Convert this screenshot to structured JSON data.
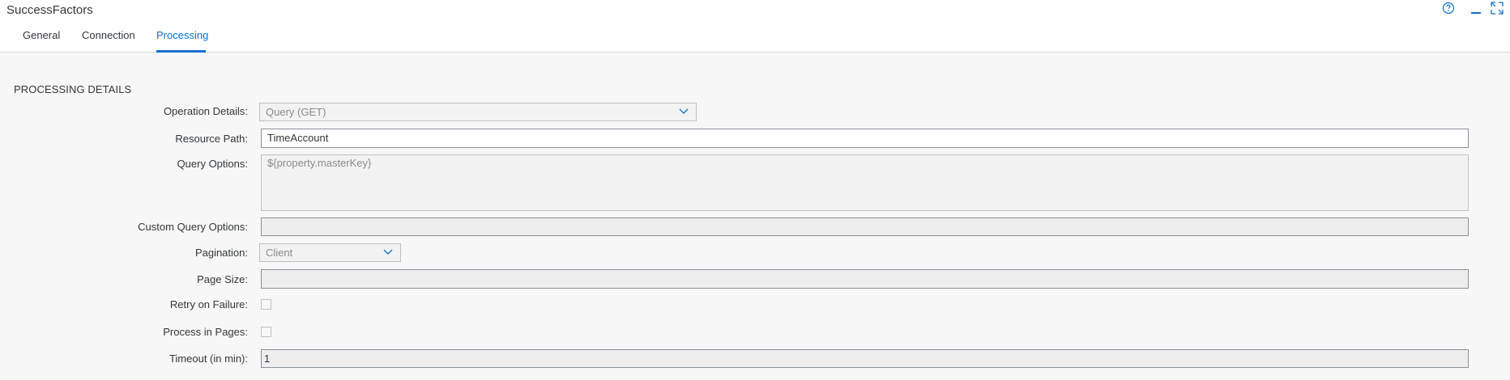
{
  "app": {
    "title": "SuccessFactors",
    "tabs": [
      {
        "label": "General"
      },
      {
        "label": "Connection"
      },
      {
        "label": "Processing",
        "active": true
      }
    ],
    "icons": {
      "help": "help-icon",
      "minimize": "minimize-icon",
      "expand": "expand-icon"
    }
  },
  "section": {
    "title": "PROCESSING DETAILS"
  },
  "form": {
    "operation_details": {
      "label": "Operation Details:",
      "value": "Query (GET)"
    },
    "resource_path": {
      "label": "Resource Path:",
      "value": "TimeAccount"
    },
    "query_options": {
      "label": "Query Options:",
      "value": "${property.masterKey}"
    },
    "custom_query_options": {
      "label": "Custom Query Options:",
      "value": ""
    },
    "pagination": {
      "label": "Pagination:",
      "value": "Client"
    },
    "page_size": {
      "label": "Page Size:",
      "value": ""
    },
    "retry_on_failure": {
      "label": "Retry on Failure:",
      "checked": false
    },
    "process_in_pages": {
      "label": "Process in Pages:",
      "checked": false
    },
    "timeout": {
      "label": "Timeout (in min):",
      "value": "1"
    }
  },
  "colors": {
    "accent": "#0a6ed1",
    "background": "#f7f7f7",
    "header": "#ffffff"
  }
}
